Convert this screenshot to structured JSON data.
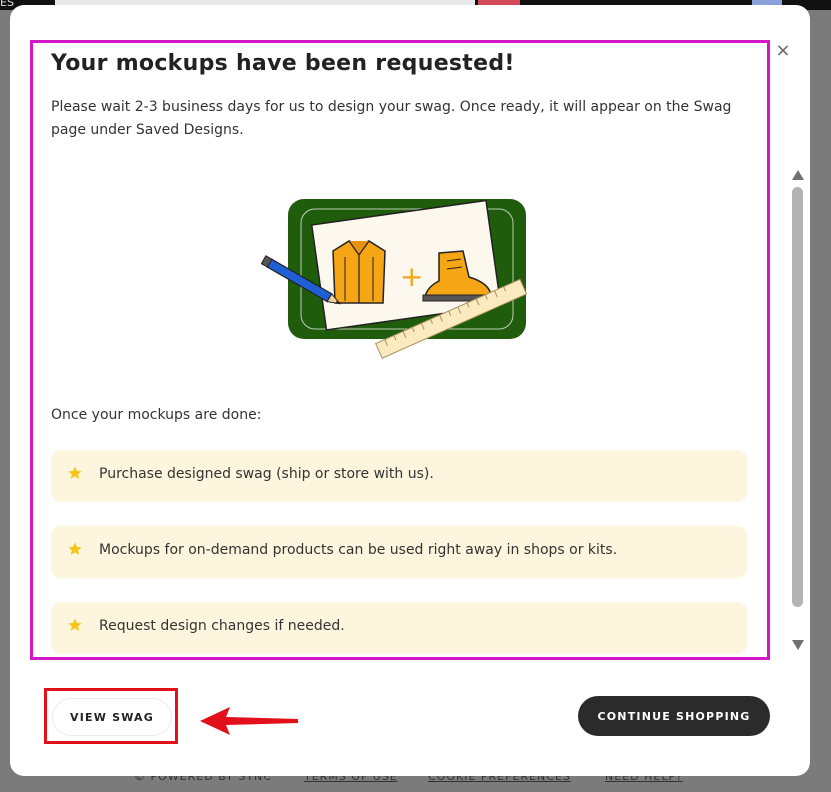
{
  "background": {
    "top_text": "ES",
    "footer": {
      "powered_by": "© POWERED BY SYNC",
      "terms": "TERMS OF USE",
      "cookies": "COOKIE PREFERENCES",
      "help": "NEED HELP?"
    }
  },
  "modal": {
    "title": "Your mockups have been requested!",
    "description": "Please wait 2-3 business days for us to design your swag. Once ready, it will appear on the Swag page under Saved Designs.",
    "illustration": {
      "plus": "+"
    },
    "list_heading": "Once your mockups are done:",
    "benefits": [
      "Purchase designed swag (ship or store with us).",
      "Mockups for on-demand products can be used right away in shops or kits.",
      "Request design changes if needed."
    ],
    "close_icon": "×",
    "buttons": {
      "view_swag": "VIEW SWAG",
      "continue_shopping": "CONTINUE SHOPPING"
    }
  },
  "colors": {
    "highlight_border": "#d417c8",
    "annotation_red": "#e1101a",
    "benefit_bg": "#fdf5dd",
    "star": "#f5c518",
    "card_green": "#1f5c0b",
    "button_dark": "#2b2b2b"
  },
  "icons": [
    "close-icon",
    "star-icon",
    "arrow-left-icon",
    "scroll-up-icon",
    "scroll-down-icon"
  ]
}
